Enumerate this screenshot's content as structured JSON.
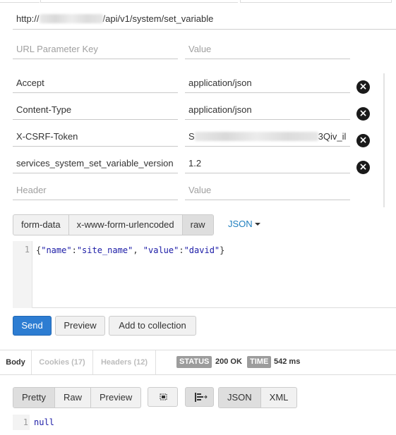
{
  "request": {
    "url_prefix": "http://",
    "url_path": "/api/v1/system/set_variable",
    "url_params": {
      "key_placeholder": "URL Parameter Key",
      "value_placeholder": "Value"
    },
    "headers": [
      {
        "key": "Accept",
        "value": "application/json"
      },
      {
        "key": "Content-Type",
        "value": "application/json"
      },
      {
        "key": "X-CSRF-Token",
        "value_start": "S",
        "value_end": "3Qiv_il"
      },
      {
        "key": "services_system_set_variable_version",
        "value": "1.2"
      }
    ],
    "header_placeholders": {
      "key": "Header",
      "value": "Value"
    },
    "remove_icon": "x-circle-icon"
  },
  "body_modes": {
    "items": [
      "form-data",
      "x-www-form-urlencoded",
      "raw"
    ],
    "active": "raw",
    "format": "JSON"
  },
  "editor": {
    "line_number": "1",
    "tokens": [
      "{",
      "\"name\"",
      ":",
      "\"site_name\"",
      ", ",
      "\"value\"",
      ":",
      "\"david\"",
      "}"
    ]
  },
  "actions": {
    "send": "Send",
    "preview": "Preview",
    "add_to_collection": "Add to collection"
  },
  "response": {
    "tabs": {
      "body": "Body",
      "cookies": "Cookies (17)",
      "headers": "Headers (12)"
    },
    "status_label": "STATUS",
    "status_value": "200 OK",
    "time_label": "TIME",
    "time_value": "542 ms",
    "view_modes": [
      "Pretty",
      "Raw",
      "Preview"
    ],
    "view_active": "Pretty",
    "formats": [
      "JSON",
      "XML"
    ],
    "format_active": "JSON",
    "line_number": "1",
    "content": "null"
  },
  "colors": {
    "send": "#2d7dd2",
    "link": "#1f7fbf",
    "json_string": "#1a1aa6"
  }
}
